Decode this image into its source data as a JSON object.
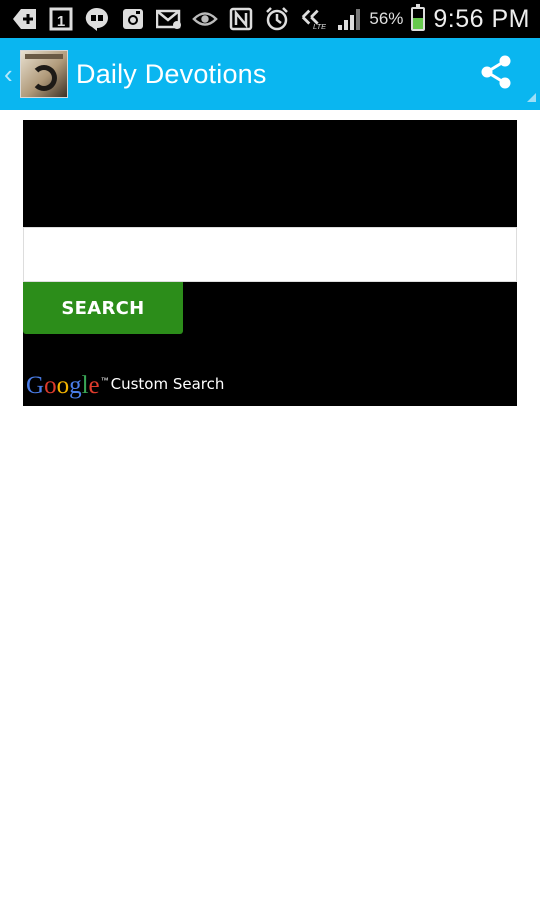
{
  "status_bar": {
    "icons": [
      "add-notification-icon",
      "calendar-1-icon",
      "hangouts-icon",
      "instagram-icon",
      "email-icon",
      "eye-icon",
      "nfc-icon",
      "alarm-icon",
      "lte-signal-icon",
      "cell-signal-icon"
    ],
    "calendar_day": "1",
    "battery_percent": "56%",
    "battery_level": 0.56,
    "time": "9:56 PM"
  },
  "action_bar": {
    "title": "Daily Devotions",
    "background_color": "#0ab6f0"
  },
  "search_widget": {
    "input_value": "",
    "input_placeholder": "",
    "button_label": "SEARCH",
    "button_color": "#2c8d1a",
    "branding": {
      "logo_text": "Google",
      "trademark": "™",
      "label": "Custom Search"
    }
  },
  "colors": {
    "accent": "#0ab6f0",
    "google_blue": "#4a7de8",
    "google_red": "#dd3b2c",
    "google_yellow": "#f4b400",
    "google_green": "#3aa757"
  }
}
